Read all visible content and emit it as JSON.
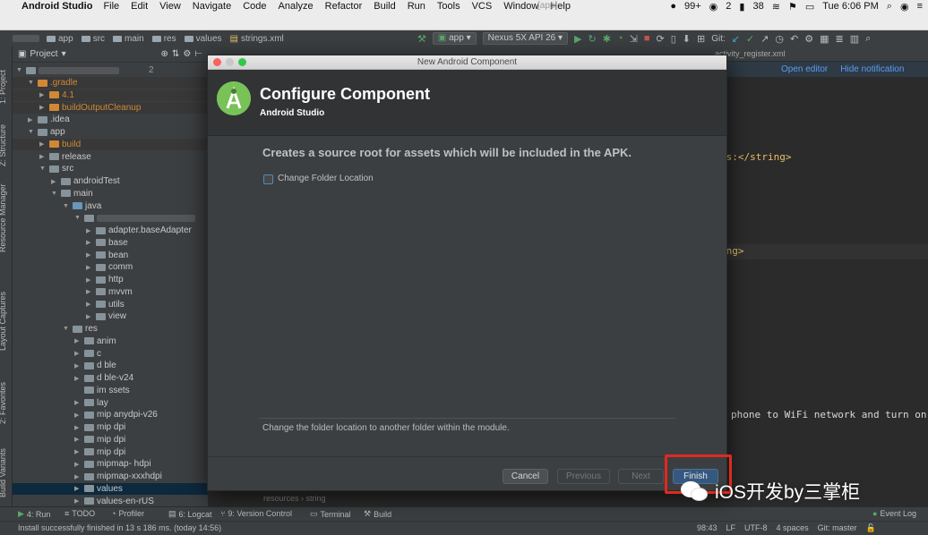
{
  "menubar": {
    "app_name": "Android Studio",
    "items": [
      "File",
      "Edit",
      "View",
      "Navigate",
      "Code",
      "Analyze",
      "Refactor",
      "Build",
      "Run",
      "Tools",
      "VCS",
      "Window",
      "Help"
    ],
    "window_title_fragment": "[app]",
    "status": {
      "notifications": "99+",
      "badge": "2",
      "battery_other": "38",
      "clock": "Tue 6:06 PM"
    }
  },
  "navbar": {
    "crumbs": [
      "app",
      "src",
      "main",
      "res",
      "values",
      "strings.xml"
    ],
    "run_config": "app",
    "device": "Nexus 5X API 26",
    "git_label": "Git:"
  },
  "project_panel": {
    "title": "Project",
    "tree_badge": "2",
    "rows": [
      {
        "label": ".gradle",
        "indent": 1,
        "arrow": "▼",
        "color": "orange"
      },
      {
        "label": "4.1",
        "indent": 2,
        "arrow": "▶",
        "color": "orange"
      },
      {
        "label": "buildOutputCleanup",
        "indent": 2,
        "arrow": "▶",
        "color": "orange"
      },
      {
        "label": ".idea",
        "indent": 1,
        "arrow": "▶",
        "color": "normal"
      },
      {
        "label": "app",
        "indent": 1,
        "arrow": "▼",
        "color": "normal"
      },
      {
        "label": "build",
        "indent": 2,
        "arrow": "▶",
        "color": "orange"
      },
      {
        "label": "release",
        "indent": 2,
        "arrow": "▶",
        "color": "normal"
      },
      {
        "label": "src",
        "indent": 2,
        "arrow": "▼",
        "color": "normal"
      },
      {
        "label": "androidTest",
        "indent": 3,
        "arrow": "▶",
        "color": "normal"
      },
      {
        "label": "main",
        "indent": 3,
        "arrow": "▼",
        "color": "normal"
      },
      {
        "label": "java",
        "indent": 4,
        "arrow": "▼",
        "color": "blue"
      },
      {
        "label": "",
        "indent": 5,
        "arrow": "▼",
        "color": "normal"
      },
      {
        "label": "adapter.baseAdapter",
        "indent": 6,
        "arrow": "▶",
        "color": "normal"
      },
      {
        "label": "base",
        "indent": 6,
        "arrow": "▶",
        "color": "normal"
      },
      {
        "label": "bean",
        "indent": 6,
        "arrow": "▶",
        "color": "normal"
      },
      {
        "label": "comm",
        "indent": 6,
        "arrow": "▶",
        "color": "normal"
      },
      {
        "label": "http",
        "indent": 6,
        "arrow": "▶",
        "color": "normal"
      },
      {
        "label": "mvvm",
        "indent": 6,
        "arrow": "▶",
        "color": "normal"
      },
      {
        "label": "utils",
        "indent": 6,
        "arrow": "▶",
        "color": "normal"
      },
      {
        "label": "view",
        "indent": 6,
        "arrow": "▶",
        "color": "normal"
      },
      {
        "label": "res",
        "indent": 4,
        "arrow": "▼",
        "color": "normal"
      },
      {
        "label": "anim",
        "indent": 5,
        "arrow": "▶",
        "color": "normal"
      },
      {
        "label": "c",
        "indent": 5,
        "arrow": "▶",
        "color": "normal"
      },
      {
        "label": "d    ble",
        "indent": 5,
        "arrow": "▶",
        "color": "normal"
      },
      {
        "label": "d    ble-v24",
        "indent": 5,
        "arrow": "▶",
        "color": "normal"
      },
      {
        "label": "im     ssets",
        "indent": 5,
        "arrow": "",
        "color": "normal"
      },
      {
        "label": "lay",
        "indent": 5,
        "arrow": "▶",
        "color": "normal"
      },
      {
        "label": "mip        anydpi-v26",
        "indent": 5,
        "arrow": "▶",
        "color": "normal"
      },
      {
        "label": "mip       dpi",
        "indent": 5,
        "arrow": "▶",
        "color": "normal"
      },
      {
        "label": "mip         dpi",
        "indent": 5,
        "arrow": "▶",
        "color": "normal"
      },
      {
        "label": "mip         dpi",
        "indent": 5,
        "arrow": "▶",
        "color": "normal"
      },
      {
        "label": "mipmap-    hdpi",
        "indent": 5,
        "arrow": "▶",
        "color": "normal"
      },
      {
        "label": "mipmap-xxxhdpi",
        "indent": 5,
        "arrow": "▶",
        "color": "normal"
      },
      {
        "label": "values",
        "indent": 5,
        "arrow": "▶",
        "color": "normal",
        "selected": true
      },
      {
        "label": "values-en-rUS",
        "indent": 5,
        "arrow": "▶",
        "color": "normal"
      }
    ]
  },
  "side_tabs": [
    "1: Project",
    "Z: Structure",
    "Resource Manager",
    "Layout Captures",
    "2: Favorites",
    "Build Variants"
  ],
  "editor": {
    "tab_visible": "activity_register.xml",
    "notification": {
      "open_editor": "Open editor",
      "hide": "Hide notification"
    },
    "code_lines": {
      "line1": "rs:</string>",
      "line2": "ing>",
      "line3": "phone to WiFi network and turn on"
    },
    "breadcrumb": [
      "resources",
      "string"
    ]
  },
  "dialog": {
    "window_title": "New Android Component",
    "title": "Configure Component",
    "subtitle": "Android Studio",
    "description": "Creates a source root for assets which will be included in the APK.",
    "checkbox_label": "Change Folder Location",
    "checkbox_checked": false,
    "hint": "Change the folder location to another folder within the module.",
    "buttons": {
      "cancel": "Cancel",
      "previous": "Previous",
      "next": "Next",
      "finish": "Finish"
    }
  },
  "tool_windows": [
    {
      "label": "4: Run"
    },
    {
      "label": "TODO"
    },
    {
      "label": "Profiler"
    },
    {
      "label": "6: Logcat"
    },
    {
      "label": "9: Version Control"
    },
    {
      "label": "Terminal"
    },
    {
      "label": "Build"
    }
  ],
  "event_log": "Event Log",
  "statusbar": {
    "message": "Install successfully finished in 13 s 186 ms. (today 14:56)",
    "position": "98:43",
    "line_sep": "LF",
    "encoding": "UTF-8",
    "indent": "4 spaces",
    "git": "Git: master"
  },
  "watermark": {
    "text": "iOS开发by三掌柜"
  },
  "colors": {
    "highlight_box": "#e0291e",
    "android_green": "#78c257",
    "link_blue": "#589df6"
  }
}
